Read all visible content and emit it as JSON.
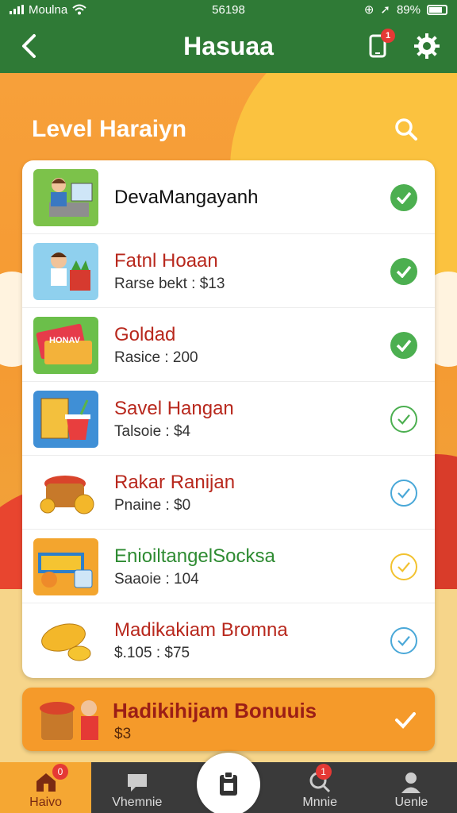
{
  "status": {
    "carrier": "Moulna",
    "time": "56198",
    "battery": "89%"
  },
  "header": {
    "title": "Hasuaa",
    "notification_count": "1"
  },
  "section": {
    "title": "Level Haraiyn"
  },
  "items": [
    {
      "title": "DevaMangayanh",
      "subtitle": "",
      "check": "green"
    },
    {
      "title": "Fatnl Hoaan",
      "subtitle": "Rarse bekt : $13",
      "check": "green"
    },
    {
      "title": "Goldad",
      "subtitle": "Rasice : 200",
      "check": "green"
    },
    {
      "title": "Savel Hangan",
      "subtitle": "Talsoie : $4",
      "check": "green-outline"
    },
    {
      "title": "Rakar Ranijan",
      "subtitle": "Pnaine : $0",
      "check": "blue-outline"
    },
    {
      "title": "EnioiltangelSocksa",
      "subtitle": "Saaoie : 104",
      "check": "yellow-outline"
    },
    {
      "title": "Madikakiam Bromna",
      "subtitle": "$.105 : $75",
      "check": "blue-outline"
    }
  ],
  "bonus": {
    "title": "Hadikihijam Bonuuis",
    "subtitle": "$3"
  },
  "nav": {
    "items": [
      {
        "label": "Haivo",
        "badge": "0"
      },
      {
        "label": "Vhemnie",
        "badge": ""
      },
      {
        "label": "",
        "badge": ""
      },
      {
        "label": "Mnnie",
        "badge": "1"
      },
      {
        "label": "Uenle",
        "badge": ""
      }
    ]
  },
  "colors": {
    "header": "#2f7a36",
    "accent": "#f5a733",
    "title_red": "#b8281d",
    "check_green": "#4caf50",
    "check_blue": "#4aa8d8",
    "check_yellow": "#f2c230"
  }
}
